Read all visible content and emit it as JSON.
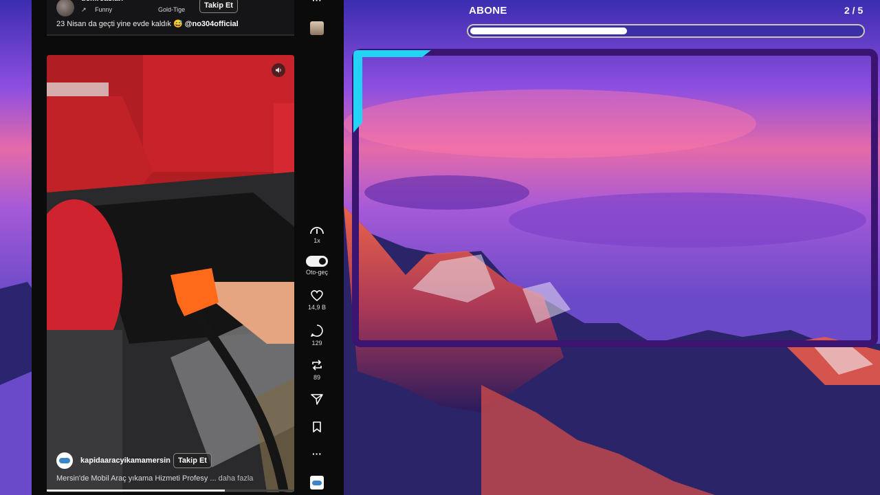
{
  "top_post": {
    "username": "demreasian",
    "sound_arrow": "↗",
    "sound_left": "Funny",
    "sound_right": "Gold-Tige",
    "follow_label": "Takip Et",
    "caption_text": "23 Nisan da geçti yine evde kaldık 😅",
    "caption_mention": "@no304official"
  },
  "video_post": {
    "username": "kapidaaracyikamamersin",
    "follow_label": "Takip Et",
    "caption": "Mersin'de Mobil Araç yıkama Hizmeti Profesy ...",
    "more_label": "daha fazla",
    "progress": 0.72
  },
  "actions": {
    "more_top": "···",
    "speed_label": "1x",
    "autoplay_label": "Oto-geç",
    "autoplay_on": true,
    "likes": "14,9 B",
    "comments": "129",
    "reposts": "89",
    "more_bottom": "···"
  },
  "overlay": {
    "goal_label": "ABONE",
    "goal_count": "2 / 5",
    "goal_progress": 0.4,
    "accent_color": "#22d3f5",
    "frame_color": "#3a1470"
  }
}
